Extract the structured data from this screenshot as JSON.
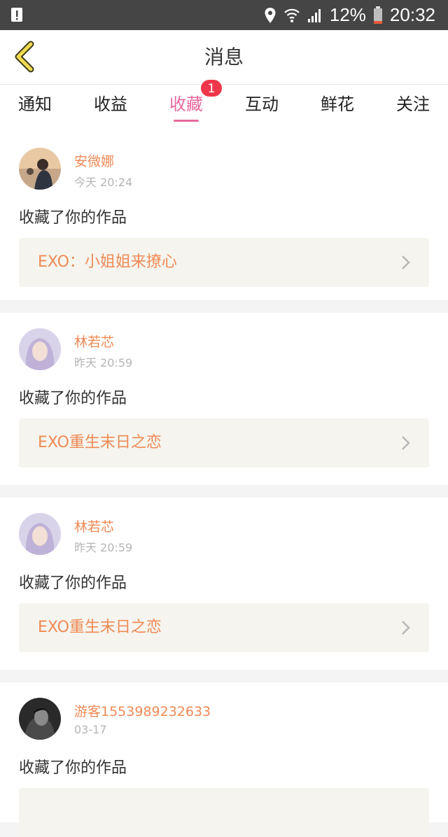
{
  "status_bar": {
    "battery_percent": "12%",
    "time": "20:32",
    "icons": [
      "alert-icon",
      "location-icon",
      "wifi-icon",
      "signal-icon",
      "battery-icon"
    ]
  },
  "header": {
    "title": "消息",
    "back_icon": "chevron-left-icon"
  },
  "tabs": [
    {
      "label": "通知"
    },
    {
      "label": "收益"
    },
    {
      "label": "收藏",
      "badge": "1"
    },
    {
      "label": "互动"
    },
    {
      "label": "鲜花"
    },
    {
      "label": "关注"
    }
  ],
  "active_tab_index": 2,
  "colors": {
    "accent_pink": "#e8689e",
    "accent_orange": "#ef8a55",
    "badge_red": "#f0364a"
  },
  "messages": [
    {
      "username": "安微娜",
      "time": "今天 20:24",
      "action": "收藏了你的作品",
      "work_title": "EXO：小姐姐来撩心"
    },
    {
      "username": "林若芯",
      "time": "昨天 20:59",
      "action": "收藏了你的作品",
      "work_title": "EXO重生末日之恋"
    },
    {
      "username": "林若芯",
      "time": "昨天 20:59",
      "action": "收藏了你的作品",
      "work_title": "EXO重生末日之恋"
    },
    {
      "username": "游客1553989232633",
      "time": "03-17",
      "action": "收藏了你的作品"
    }
  ]
}
